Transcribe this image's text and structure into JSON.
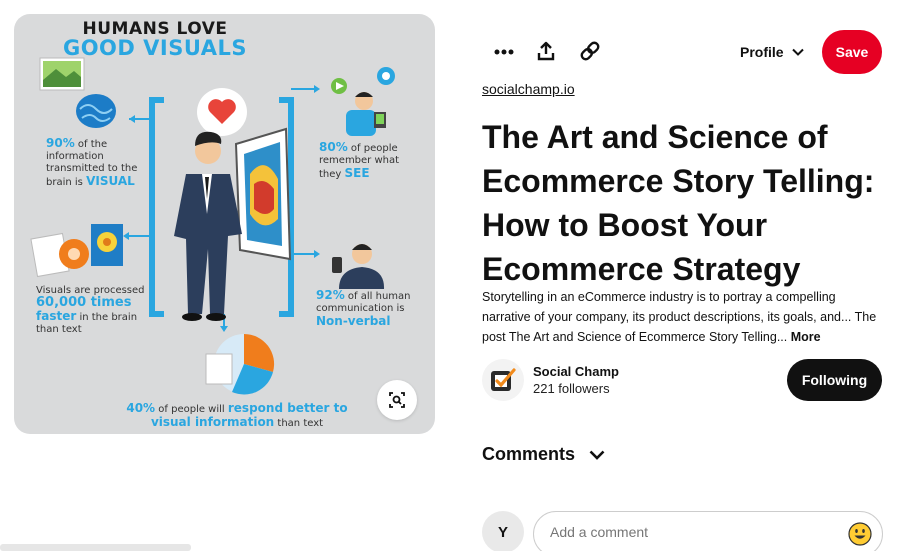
{
  "infographic": {
    "title_line1": "HUMANS LOVE",
    "title_line2": "GOOD VISUALS",
    "stat1": {
      "value": "90%",
      "text": "of the information transmitted to the brain is",
      "highlight": "VISUAL"
    },
    "stat2": {
      "value": "80%",
      "text": "of people remember what they",
      "highlight": "SEE"
    },
    "stat3": {
      "text": "Visuals are processed",
      "value": "60,000 times",
      "highlight": "faster",
      "tail": "in the brain than text"
    },
    "stat4": {
      "value": "92%",
      "text": "of all human communication is",
      "highlight": "Non-verbal"
    },
    "stat5": {
      "value": "40%",
      "text": "of people will",
      "highlight": "respond better to visual information",
      "tail": "than text"
    },
    "colors": {
      "accent": "#2aa6e0",
      "orange": "#f07d1c",
      "suit": "#2c3e5c"
    }
  },
  "toolbar": {
    "more_icon": "ellipsis-icon",
    "share_icon": "share-icon",
    "link_icon": "link-icon",
    "profile_label": "Profile",
    "save_label": "Save"
  },
  "pin": {
    "source": "socialchamp.io",
    "title": "The Art and Science of Ecommerce Story Telling: How to Boost Your Ecommerce Strategy",
    "description": "Storytelling in an eCommerce industry is to portray a compelling narrative of your company, its product descriptions, its goals, and... The post The Art and Science of Ecommerce Story Telling...",
    "more_label": "More"
  },
  "creator": {
    "name": "Social Champ",
    "followers": "221 followers",
    "follow_label": "Following"
  },
  "comments": {
    "heading": "Comments",
    "user_initial": "Y",
    "placeholder": "Add a comment"
  },
  "colors": {
    "save": "#e60023",
    "following": "#111111"
  }
}
